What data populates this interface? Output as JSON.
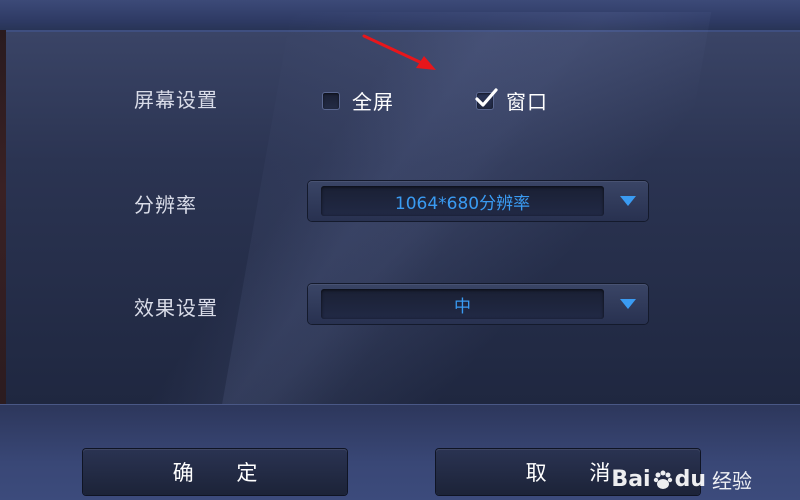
{
  "settings": {
    "screen_label": "屏幕设置",
    "fullscreen": {
      "label": "全屏",
      "checked": false
    },
    "windowed": {
      "label": "窗口",
      "checked": true
    },
    "resolution_label": "分辨率",
    "resolution_value": "1064*680分辨率",
    "effects_label": "效果设置",
    "effects_value": "中"
  },
  "buttons": {
    "confirm": "确 定",
    "cancel": "取 消"
  },
  "watermark": {
    "bai": "Bai",
    "du": "du",
    "jingyan": "经验"
  },
  "colors": {
    "accent_text": "#3a9bf2",
    "annotation_arrow": "#e8161b"
  }
}
